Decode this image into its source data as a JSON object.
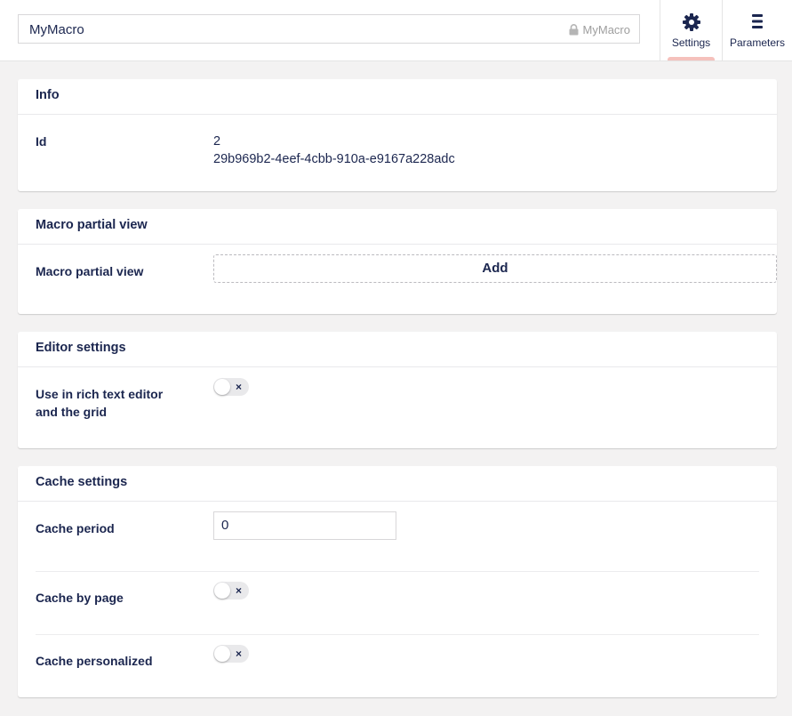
{
  "header": {
    "name_value": "MyMacro",
    "alias_value": "MyMacro",
    "tabs": [
      {
        "label": "Settings",
        "icon": "gear-icon",
        "active": true
      },
      {
        "label": "Parameters",
        "icon": "list-icon",
        "active": false
      }
    ]
  },
  "info": {
    "title": "Info",
    "id_label": "Id",
    "id_value": "2",
    "guid_value": "29b969b2-4eef-4cbb-910a-e9167a228adc"
  },
  "partial": {
    "title": "Macro partial view",
    "label": "Macro partial view",
    "add_label": "Add"
  },
  "editor": {
    "title": "Editor settings",
    "rte_label": "Use in rich text editor and the grid",
    "rte_checked": false
  },
  "cache": {
    "title": "Cache settings",
    "period_label": "Cache period",
    "period_value": "0",
    "by_page_label": "Cache by page",
    "by_page_checked": false,
    "personalized_label": "Cache personalized",
    "personalized_checked": false
  },
  "toggle_off_symbol": "×",
  "colors": {
    "accent_bar": "#f5c1bc",
    "text": "#1b264f",
    "background": "#f3f2f2"
  }
}
